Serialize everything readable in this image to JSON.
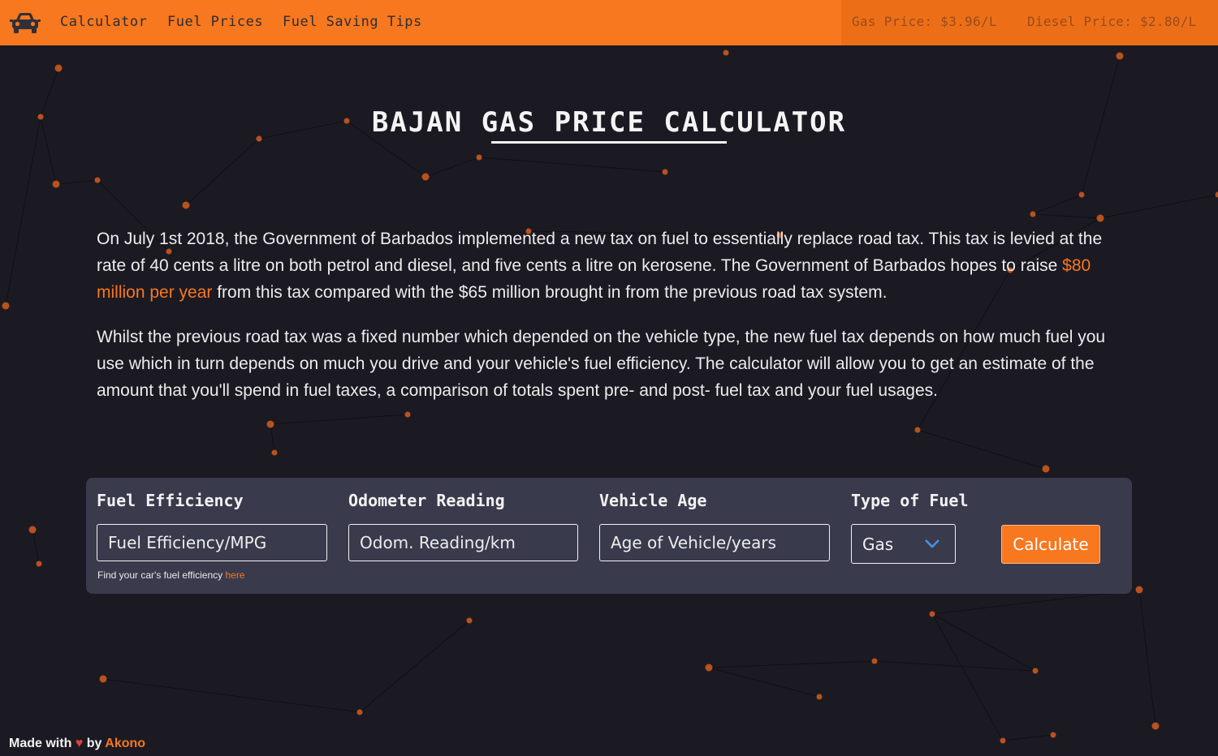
{
  "nav": {
    "links": [
      "Calculator",
      "Fuel Prices",
      "Fuel Saving Tips"
    ],
    "gas_price": "Gas Price: $3.96/L",
    "diesel_price": "Diesel Price: $2.80/L"
  },
  "page": {
    "title": "BAJAN GAS PRICE CALCULATOR",
    "para1_before": "On July 1st 2018, the Government of Barbados implemented a new tax on fuel to essentially replace road tax. This tax is levied at the rate of 40 cents a litre on both petrol and diesel, and five cents a litre on kerosene. The Government of Barbados hopes to raise ",
    "para1_highlight": "$80 million per year",
    "para1_after": " from this tax compared with the $65 million brought in from the previous road tax system.",
    "para2": "Whilst the previous road tax was a fixed number which depended on the vehicle type, the new fuel tax depends on how much fuel you use which in turn depends on much you drive and your vehicle's fuel efficiency. The calculator will allow you to get an estimate of the amount that you'll spend in fuel taxes, a comparison of totals spent pre- and post- fuel tax and your fuel usages."
  },
  "form": {
    "efficiency_label": "Fuel Efficiency",
    "efficiency_placeholder": "Fuel Efficiency/MPG",
    "odometer_label": "Odometer Reading",
    "odometer_placeholder": "Odom. Reading/km",
    "age_label": "Vehicle Age",
    "age_placeholder": "Age of Vehicle/years",
    "fuel_label": "Type of Fuel",
    "fuel_selected": "Gas",
    "calculate_label": "Calculate",
    "hint_text": "Find your car's fuel efficiency ",
    "hint_link": "here"
  },
  "footer": {
    "made_with": "Made with",
    "heart": "♥",
    "by": " by ",
    "author": "Akono"
  },
  "colors": {
    "accent": "#f7781e",
    "background": "#1b1a23",
    "panel": "#3a3a4d"
  },
  "icons": [
    "car-icon",
    "chevron-down-icon",
    "heart-icon"
  ]
}
